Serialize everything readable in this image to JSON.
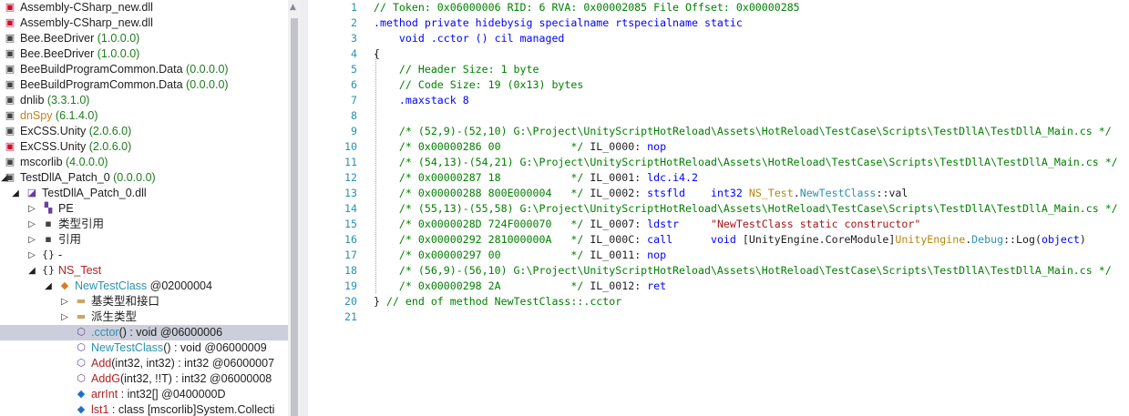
{
  "tree": {
    "items": [
      {
        "indent": 0,
        "icon": "assembly-error-icon",
        "label": "Assembly-CSharp_new.dll",
        "version": "",
        "color": "#1e1e1e"
      },
      {
        "indent": 0,
        "icon": "assembly-error-icon",
        "label": "Assembly-CSharp_new.dll",
        "version": "",
        "color": "#1e1e1e"
      },
      {
        "indent": 0,
        "icon": "assembly-icon",
        "label": "Bee.BeeDriver",
        "version": "(1.0.0.0)",
        "color": "#1e1e1e"
      },
      {
        "indent": 0,
        "icon": "assembly-icon",
        "label": "Bee.BeeDriver",
        "version": "(1.0.0.0)",
        "color": "#1e1e1e"
      },
      {
        "indent": 0,
        "icon": "assembly-icon",
        "label": "BeeBuildProgramCommon.Data",
        "version": "(0.0.0.0)",
        "color": "#1e1e1e"
      },
      {
        "indent": 0,
        "icon": "assembly-icon",
        "label": "BeeBuildProgramCommon.Data",
        "version": "(0.0.0.0)",
        "color": "#1e1e1e"
      },
      {
        "indent": 0,
        "icon": "assembly-icon",
        "label": "dnlib",
        "version": "(3.3.1.0)",
        "color": "#1e1e1e"
      },
      {
        "indent": 0,
        "icon": "assembly-icon",
        "label": "dnSpy",
        "version": "(6.1.4.0)",
        "color": "#c38416"
      },
      {
        "indent": 0,
        "icon": "assembly-icon",
        "label": "ExCSS.Unity",
        "version": "(2.0.6.0)",
        "color": "#1e1e1e"
      },
      {
        "indent": 0,
        "icon": "assembly-error-icon",
        "label": "ExCSS.Unity",
        "version": "(2.0.6.0)",
        "color": "#1e1e1e"
      },
      {
        "indent": 0,
        "icon": "assembly-icon",
        "label": "mscorlib",
        "version": "(4.0.0.0)",
        "color": "#1e1e1e"
      },
      {
        "indent": 0,
        "icon": "assembly-icon",
        "label": "TestDllA_Patch_0",
        "version": "(0.0.0.0)",
        "color": "#1e1e1e",
        "expanded": true
      },
      {
        "indent": 1,
        "icon": "module-icon",
        "label": "TestDllA_Patch_0.dll",
        "version": "",
        "color": "#1e1e1e",
        "expanded": true
      },
      {
        "indent": 2,
        "icon": "pe-icon",
        "label": "PE",
        "version": "",
        "color": "#1e1e1e",
        "collapsed": true
      },
      {
        "indent": 2,
        "icon": "references-icon",
        "label": "类型引用",
        "version": "",
        "color": "#1e1e1e",
        "collapsed": true
      },
      {
        "indent": 2,
        "icon": "references-icon",
        "label": "引用",
        "version": "",
        "color": "#1e1e1e",
        "collapsed": true
      },
      {
        "indent": 2,
        "icon": "namespace-icon",
        "label": "-",
        "version": "",
        "color": "#1e1e1e",
        "collapsed": true
      },
      {
        "indent": 2,
        "icon": "namespace-icon",
        "label": "NS_Test",
        "version": "",
        "color": "#b22222",
        "expanded": true
      },
      {
        "indent": 3,
        "icon": "class-icon",
        "label": "NewTestClass",
        "version": "@02000004",
        "color": "#2b91af",
        "expanded": true
      },
      {
        "indent": 4,
        "icon": "folder-icon",
        "label": "基类型和接口",
        "version": "",
        "color": "#1e1e1e",
        "collapsed": true
      },
      {
        "indent": 4,
        "icon": "folder-icon",
        "label": "派生类型",
        "version": "",
        "color": "#1e1e1e",
        "collapsed": true
      },
      {
        "indent": 4,
        "icon": "method-lock-icon",
        "label": ".cctor",
        "version": "() : void @06000006",
        "color": "#2b91af",
        "selected": true
      },
      {
        "indent": 4,
        "icon": "method-icon",
        "label": "NewTestClass",
        "version": "() : void @06000009",
        "color": "#2b91af"
      },
      {
        "indent": 4,
        "icon": "method-icon",
        "label": "Add",
        "version": "(int32, int32) : int32 @06000007",
        "color": "#b22222"
      },
      {
        "indent": 4,
        "icon": "method-icon",
        "label": "AddG",
        "version": "(int32, !!T) : int32 @06000008",
        "color": "#b22222"
      },
      {
        "indent": 4,
        "icon": "field-icon",
        "label": "arrInt",
        "version": ": int32[] @0400000D",
        "color": "#b22222"
      },
      {
        "indent": 4,
        "icon": "field-icon",
        "label": "lst1",
        "version": ": class [mscorlib]System.Collecti",
        "color": "#b22222"
      }
    ]
  },
  "code": {
    "line_numbers": [
      "1",
      "2",
      "3",
      "4",
      "5",
      "6",
      "7",
      "8",
      "9",
      "10",
      "11",
      "12",
      "13",
      "14",
      "15",
      "16",
      "17",
      "18",
      "19",
      "20",
      "21"
    ],
    "lines": [
      [
        {
          "t": "// Token: 0x06000006 RID: 6 RVA: 0x00002085 File Offset: 0x00000285",
          "c": "c"
        }
      ],
      [
        {
          "t": ".method private hidebysig specialname rtspecialname static",
          "c": "k"
        }
      ],
      [
        {
          "t": "    void .cctor () cil managed",
          "c": "k"
        }
      ],
      [
        {
          "t": "{",
          "c": "il"
        }
      ],
      [
        {
          "t": "    // Header Size: 1 byte",
          "c": "c"
        }
      ],
      [
        {
          "t": "    // Code Size: 19 (0x13) bytes",
          "c": "c"
        }
      ],
      [
        {
          "t": "    .maxstack 8",
          "c": "k"
        }
      ],
      [
        {
          "t": "",
          "c": "il"
        }
      ],
      [
        {
          "t": "    /* (52,9)-(52,10) G:\\Project\\UnityScriptHotReload\\Assets\\HotReload\\TestCase\\Scripts\\TestDllA\\TestDllA_Main.cs */",
          "c": "c"
        }
      ],
      [
        {
          "t": "    /* 0x00000286 00           */ ",
          "c": "c"
        },
        {
          "t": "IL_0000: ",
          "c": "il"
        },
        {
          "t": "nop",
          "c": "k"
        }
      ],
      [
        {
          "t": "    /* (54,13)-(54,21) G:\\Project\\UnityScriptHotReload\\Assets\\HotReload\\TestCase\\Scripts\\TestDllA\\TestDllA_Main.cs */",
          "c": "c"
        }
      ],
      [
        {
          "t": "    /* 0x00000287 18           */ ",
          "c": "c"
        },
        {
          "t": "IL_0001: ",
          "c": "il"
        },
        {
          "t": "ldc.i4.2",
          "c": "k"
        }
      ],
      [
        {
          "t": "    /* 0x00000288 800E000004   */ ",
          "c": "c"
        },
        {
          "t": "IL_0002: ",
          "c": "il"
        },
        {
          "t": "stsfld    ",
          "c": "k"
        },
        {
          "t": "int32 ",
          "c": "k"
        },
        {
          "t": "NS_Test",
          "c": "ns"
        },
        {
          "t": ".",
          "c": "il"
        },
        {
          "t": "NewTestClass",
          "c": "cls"
        },
        {
          "t": "::val",
          "c": "il"
        }
      ],
      [
        {
          "t": "    /* (55,13)-(55,58) G:\\Project\\UnityScriptHotReload\\Assets\\HotReload\\TestCase\\Scripts\\TestDllA\\TestDllA_Main.cs */",
          "c": "c"
        }
      ],
      [
        {
          "t": "    /* 0x0000028D 724F000070   */ ",
          "c": "c"
        },
        {
          "t": "IL_0007: ",
          "c": "il"
        },
        {
          "t": "ldstr     ",
          "c": "k"
        },
        {
          "t": "\"NewTestClass static constructor\"",
          "c": "o"
        }
      ],
      [
        {
          "t": "    /* 0x00000292 281000000A   */ ",
          "c": "c"
        },
        {
          "t": "IL_000C: ",
          "c": "il"
        },
        {
          "t": "call      ",
          "c": "k"
        },
        {
          "t": "void ",
          "c": "k"
        },
        {
          "t": "[UnityEngine.CoreModule]",
          "c": "il"
        },
        {
          "t": "UnityEngine",
          "c": "ns"
        },
        {
          "t": ".",
          "c": "il"
        },
        {
          "t": "Debug",
          "c": "cls"
        },
        {
          "t": "::Log(",
          "c": "il"
        },
        {
          "t": "object",
          "c": "k"
        },
        {
          "t": ")",
          "c": "il"
        }
      ],
      [
        {
          "t": "    /* 0x00000297 00           */ ",
          "c": "c"
        },
        {
          "t": "IL_0011: ",
          "c": "il"
        },
        {
          "t": "nop",
          "c": "k"
        }
      ],
      [
        {
          "t": "    /* (56,9)-(56,10) G:\\Project\\UnityScriptHotReload\\Assets\\HotReload\\TestCase\\Scripts\\TestDllA\\TestDllA_Main.cs */",
          "c": "c"
        }
      ],
      [
        {
          "t": "    /* 0x00000298 2A           */ ",
          "c": "c"
        },
        {
          "t": "IL_0012: ",
          "c": "il"
        },
        {
          "t": "ret",
          "c": "k"
        }
      ],
      [
        {
          "t": "} ",
          "c": "il"
        },
        {
          "t": "// end of method NewTestClass::.cctor",
          "c": "c"
        }
      ],
      [
        {
          "t": "",
          "c": "il"
        }
      ]
    ]
  }
}
